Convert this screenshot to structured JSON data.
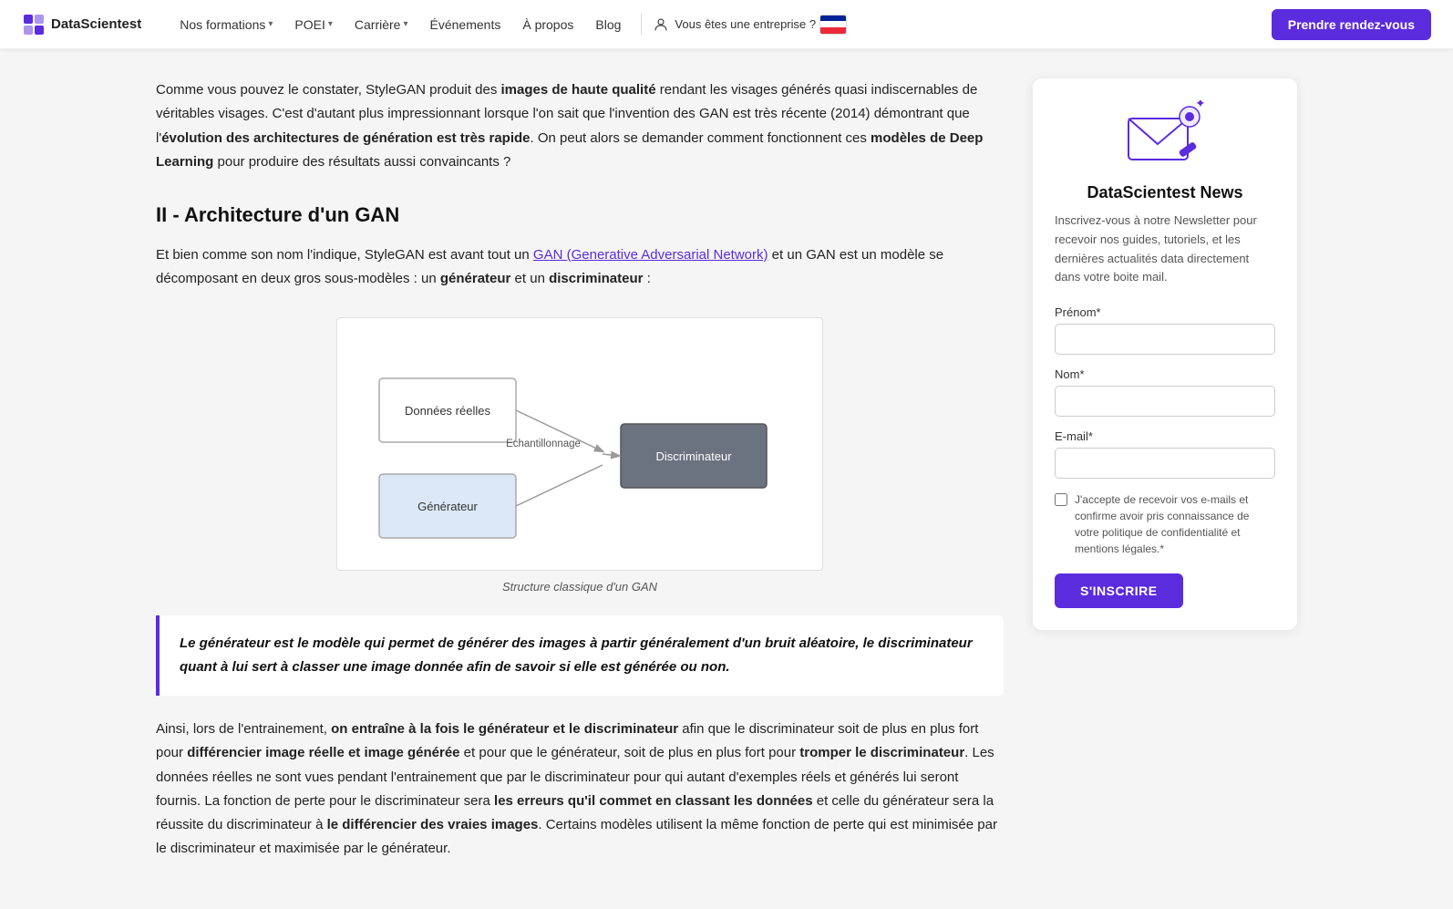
{
  "navbar": {
    "logo_text": "DataScientest",
    "links": [
      {
        "label": "Nos formations",
        "has_dropdown": true
      },
      {
        "label": "POEI",
        "has_dropdown": true
      },
      {
        "label": "Carrière",
        "has_dropdown": true
      },
      {
        "label": "Événements",
        "has_dropdown": false
      },
      {
        "label": "À propos",
        "has_dropdown": false
      },
      {
        "label": "Blog",
        "has_dropdown": false
      }
    ],
    "enterprise_label": "Vous êtes une entreprise ?",
    "cta_label": "Prendre rendez-vous"
  },
  "article": {
    "intro_text_1": "Comme vous pouvez le constater, StyleGAN produit des ",
    "intro_bold_1": "images de haute qualité",
    "intro_text_2": " rendant les visages générés quasi indiscernables de véritables visages. C'est d'autant plus impressionnant lorsque l'on sait que l'invention des GAN est très récente (2014) démontrant que l'",
    "intro_bold_2": "évolution des architectures de génération est très rapide",
    "intro_text_3": ". On peut alors se demander comment fonctionnent ces ",
    "intro_bold_3": "modèles de Deep Learning",
    "intro_text_4": " pour produire des résultats aussi convaincants ?",
    "section_heading": "II - Architecture d'un GAN",
    "section_text_1": "Et bien comme son nom l'indique, StyleGAN est avant tout un ",
    "section_link": "GAN (Generative Adversarial Network)",
    "section_text_2": " et un GAN est un modèle se décomposant en deux gros sous-modèles : un ",
    "section_bold_1": "générateur",
    "section_text_3": " et un ",
    "section_bold_2": "discriminateur",
    "section_text_4": " :",
    "diagram_caption": "Structure classique d'un GAN",
    "diagram_labels": {
      "donnees": "Données réelles",
      "generateur": "Générateur",
      "echantillonnage": "Echantillonnage",
      "discriminateur": "Discriminateur"
    },
    "highlight_text": "Le générateur est le modèle qui permet de générer des images à partir généralement d'un bruit aléatoire, le discriminateur quant à lui sert à classer une image donnée afin de savoir si elle est générée ou non.",
    "body_text_1": "Ainsi, lors de l'entrainement, ",
    "body_bold_1": "on entraîne à la fois le générateur et le discriminateur",
    "body_text_2": " afin que le discriminateur soit de plus en plus fort pour ",
    "body_bold_2": "différencier image réelle et image générée",
    "body_text_3": " et pour que le générateur, soit de plus en plus fort pour ",
    "body_bold_3": "tromper le discriminateur",
    "body_text_4": ". Les données réelles ne sont vues pendant l'entrainement que par le discriminateur pour qui autant d'exemples réels et générés lui seront fournis. La fonction de perte pour le discriminateur sera ",
    "body_bold_4": "les erreurs qu'il commet en classant les données",
    "body_text_5": " et celle du générateur sera la réussite du discriminateur à ",
    "body_bold_5": "le différencier des vraies images",
    "body_text_6": ". Certains modèles utilisent la même fonction de perte qui est minimisée par le discriminateur et maximisée par le générateur."
  },
  "sidebar": {
    "title": "DataScientest News",
    "description": "Inscrivez-vous à notre Newsletter pour recevoir nos guides, tutoriels, et les dernières actualités data directement dans votre boite mail.",
    "form": {
      "prenom_label": "Prénom*",
      "prenom_placeholder": "",
      "nom_label": "Nom*",
      "nom_placeholder": "",
      "email_label": "E-mail*",
      "email_placeholder": "",
      "checkbox_label": "J'accepte de recevoir vos e-mails et confirme avoir pris connaissance de votre politique de confidentialité et mentions légales.*",
      "submit_label": "S'INSCRIRE"
    }
  }
}
